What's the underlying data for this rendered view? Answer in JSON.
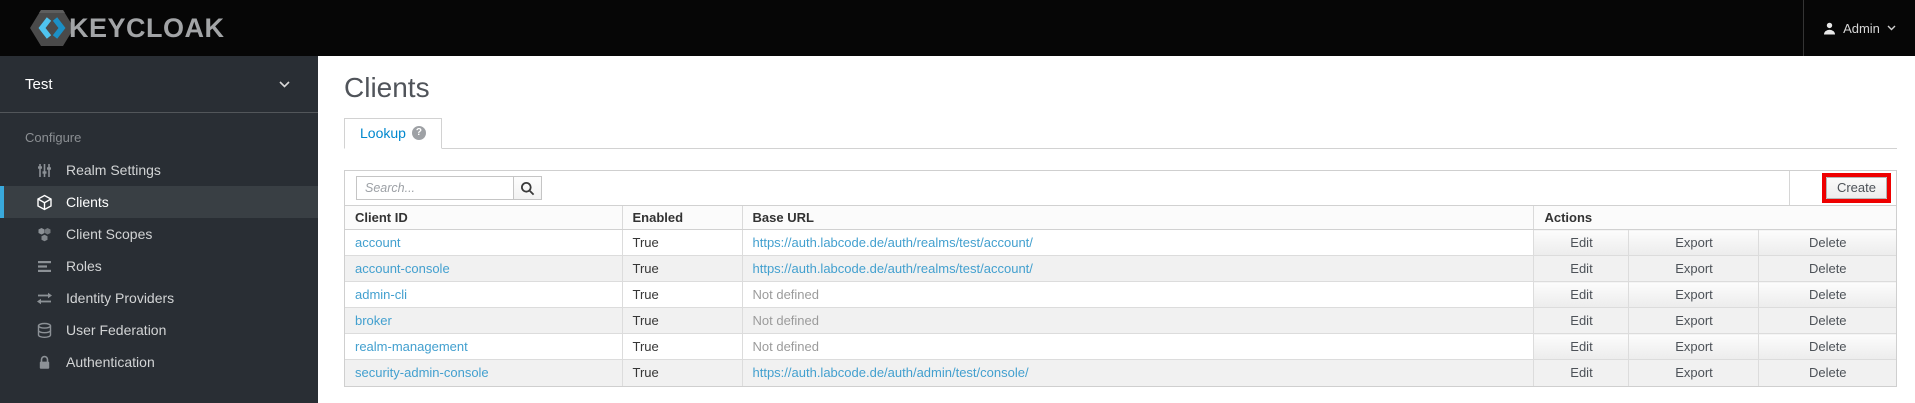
{
  "header": {
    "logo_text": "KEYCLOAK",
    "user_name": "Admin"
  },
  "sidebar": {
    "realm_name": "Test",
    "section_label": "Configure",
    "items": [
      {
        "label": "Realm Settings",
        "icon": "sliders-icon"
      },
      {
        "label": "Clients",
        "icon": "cube-icon"
      },
      {
        "label": "Client Scopes",
        "icon": "cubes-icon"
      },
      {
        "label": "Roles",
        "icon": "list-icon"
      },
      {
        "label": "Identity Providers",
        "icon": "exchange-icon"
      },
      {
        "label": "User Federation",
        "icon": "database-icon"
      },
      {
        "label": "Authentication",
        "icon": "lock-icon"
      }
    ]
  },
  "main": {
    "page_title": "Clients",
    "tabs": [
      {
        "label": "Lookup"
      }
    ],
    "help_glyph": "?",
    "toolbar": {
      "search_placeholder": "Search...",
      "create_label": "Create"
    },
    "table": {
      "columns": [
        "Client ID",
        "Enabled",
        "Base URL",
        "Actions"
      ],
      "action_labels": [
        "Edit",
        "Export",
        "Delete"
      ],
      "rows": [
        {
          "client_id": "account",
          "enabled": "True",
          "base_url": "https://auth.labcode.de/auth/realms/test/account/"
        },
        {
          "client_id": "account-console",
          "enabled": "True",
          "base_url": "https://auth.labcode.de/auth/realms/test/account/"
        },
        {
          "client_id": "admin-cli",
          "enabled": "True",
          "base_url": "Not defined"
        },
        {
          "client_id": "broker",
          "enabled": "True",
          "base_url": "Not defined"
        },
        {
          "client_id": "realm-management",
          "enabled": "True",
          "base_url": "Not defined"
        },
        {
          "client_id": "security-admin-console",
          "enabled": "True",
          "base_url": "https://auth.labcode.de/auth/admin/test/console/"
        }
      ]
    }
  },
  "colors": {
    "tab_link_blue": "#0088ce",
    "table_link_blue": "#43a0cf",
    "annotation_red": "#ee0000",
    "sidebar_bg": "#292e34",
    "sidebar_active_border": "#39a9dc",
    "topbar_black": "#060606"
  }
}
